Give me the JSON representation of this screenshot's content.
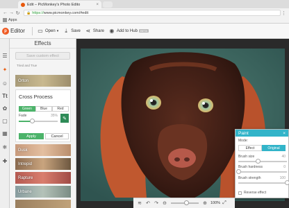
{
  "browser": {
    "tab_title": "Edit – PicMonkey's Photo Edito",
    "close_glyph": "×",
    "url_scheme": "https://",
    "url_rest": "www.picmonkey.com/#edit",
    "bookmarks_label": "Apps"
  },
  "toolbar": {
    "logo_mark": "p",
    "logo_word": "Editor",
    "open_label": "Open",
    "save_label": "Save",
    "share_label": "Share",
    "hub_label": "Add to Hub",
    "beta_label": "BETA"
  },
  "effects": {
    "title": "Effects",
    "save_custom": "Save custom effect",
    "category": "Tried and True",
    "thumbs": {
      "orton": "Orton",
      "dusk": "Dusk",
      "intrepid": "Intrepid",
      "rapture": "Rapture",
      "urbane": "Urbane"
    },
    "cross_process": {
      "title": "Cross Process",
      "options": [
        "Green",
        "Blue",
        "Red"
      ],
      "selected": "Green",
      "fade_label": "Fade",
      "fade_value": "35%",
      "fade_fraction": 0.35,
      "apply_label": "Apply",
      "cancel_label": "Cancel"
    }
  },
  "paint": {
    "title": "Paint",
    "close": "×",
    "mode_label": "Mode:",
    "modes": [
      "Effect",
      "Original"
    ],
    "selected_mode": "Original",
    "brush_size_label": "Brush size",
    "brush_size_value": "40",
    "brush_size_fraction": 0.4,
    "brush_hardness_label": "Brush hardness",
    "brush_hardness_value": "0",
    "brush_hardness_fraction": 0,
    "brush_strength_label": "Brush strength",
    "brush_strength_value": "100",
    "brush_strength_fraction": 1,
    "reverse_label": "Reverse effect"
  },
  "bottom": {
    "zoom_value": "100%",
    "zoom_fraction": 0.55
  },
  "colors": {
    "accent_green": "#4cb36a",
    "paint_teal": "#32b4c9",
    "brand_orange": "#ef5b24"
  }
}
